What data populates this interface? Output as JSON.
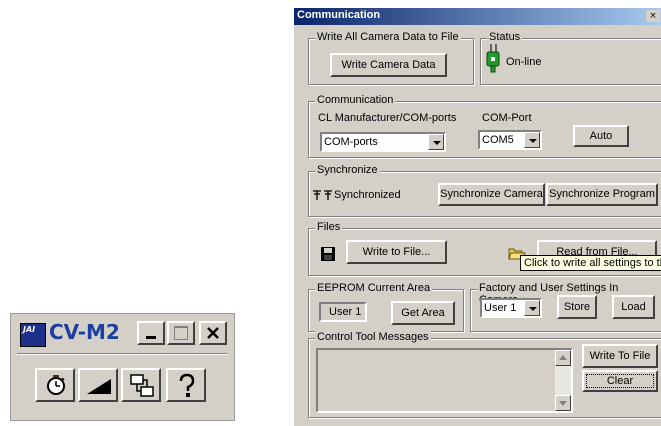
{
  "toolbar_window": {
    "logo_text": "JAI",
    "title": "CV-M2",
    "buttons": [
      {
        "icon": "stopwatch-icon"
      },
      {
        "icon": "gain-ramp-icon"
      },
      {
        "icon": "network-icon"
      },
      {
        "icon": "help-icon"
      }
    ]
  },
  "dialog": {
    "title": "Communication",
    "write_all": {
      "group_label": "Write All Camera Data to File",
      "button": "Write Camera Data"
    },
    "status": {
      "group_label": "Status",
      "value": "On-line"
    },
    "communication": {
      "group_label": "Communication",
      "manufacturer_label": "CL Manufacturer/COM-ports",
      "manufacturer_value": "COM-ports",
      "port_label": "COM-Port",
      "port_value": "COM5",
      "auto_button": "Auto"
    },
    "synchronize": {
      "group_label": "Synchronize",
      "status_text": "Synchronized",
      "sync_camera_button": "Synchronize Camera",
      "sync_program_button": "Synchronize Program"
    },
    "files": {
      "group_label": "Files",
      "write_button": "Write to File...",
      "read_button": "Read from File...",
      "tooltip": "Click to write all settings to th"
    },
    "eeprom": {
      "group_label": "EEPROM Current Area",
      "current_area": "User 1",
      "get_area_button": "Get Area"
    },
    "factory": {
      "group_label": "Factory and User Settings In Camera",
      "selected": "User 1",
      "store_button": "Store",
      "load_button": "Load"
    },
    "messages": {
      "group_label": "Control Tool Messages",
      "write_button": "Write To File",
      "clear_button": "Clear"
    }
  }
}
